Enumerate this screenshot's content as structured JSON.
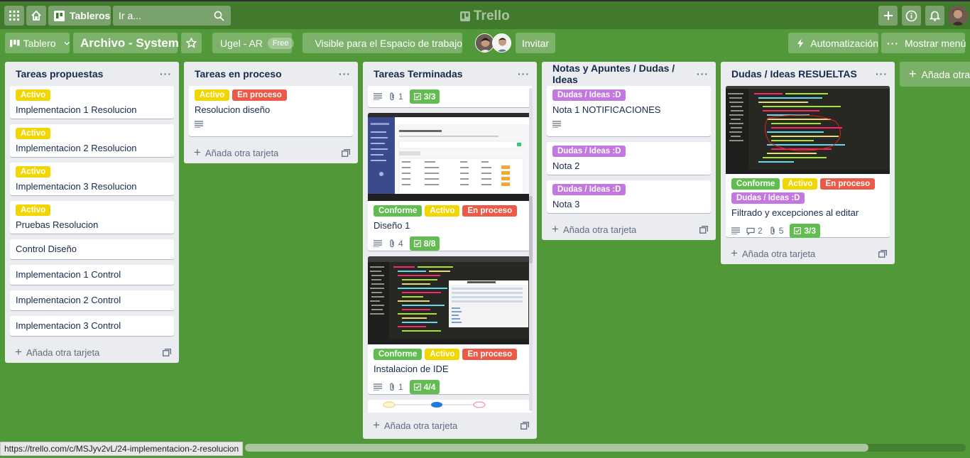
{
  "topbar": {
    "boards_label": "Tableros",
    "search_placeholder": "Ir a...",
    "logo_text": "Trello"
  },
  "board_header": {
    "view_label": "Tablero",
    "board_name": "Archivo - System",
    "workspace_name": "Ugel - AR",
    "workspace_plan": "Free",
    "visibility_label": "Visible para el Espacio de trabajo",
    "invite_label": "Invitar",
    "automation_label": "Automatización",
    "menu_label": "Mostrar menú"
  },
  "colors": {
    "board_bg": "#519839",
    "label_yellow": "#f2d600",
    "label_red": "#eb5a46",
    "label_green": "#61bd4f",
    "label_purple": "#c377e0"
  },
  "lists": [
    {
      "title": "Tareas propuestas",
      "add_label": "Añada otra tarjeta",
      "cards": [
        {
          "labels": [
            "Activo"
          ],
          "title": "Implementacion 1 Resolucion"
        },
        {
          "labels": [
            "Activo"
          ],
          "title": "Implementacion 2 Resolucion"
        },
        {
          "labels": [
            "Activo"
          ],
          "title": "Implementacion 3 Resolucion"
        },
        {
          "labels": [
            "Activo"
          ],
          "title": "Pruebas Resolucion"
        },
        {
          "title": "Control Diseño"
        },
        {
          "title": "Implementacion 1 Control"
        },
        {
          "title": "Implementacion 2 Control"
        },
        {
          "title": "Implementacion 3 Control"
        }
      ]
    },
    {
      "title": "Tareas en proceso",
      "add_label": "Añada otra tarjeta",
      "cards": [
        {
          "labels": [
            "Activo",
            "En proceso"
          ],
          "title": "Resolucion diseño"
        }
      ]
    },
    {
      "title": "Tareas Terminadas",
      "add_label": "Añada otra tarjeta",
      "cards": [
        {
          "attachments": "1",
          "checklist": "3/3"
        },
        {
          "labels": [
            "Conforme",
            "Activo",
            "En proceso"
          ],
          "title": "Diseño 1",
          "attachments": "4",
          "checklist": "8/8"
        },
        {
          "labels": [
            "Conforme",
            "Activo",
            "En proceso"
          ],
          "title": "Instalacion de IDE",
          "attachments": "1",
          "checklist": "4/4"
        }
      ]
    },
    {
      "title": "Notas y Apuntes / Dudas / Ideas",
      "add_label": "Añada otra tarjeta",
      "cards": [
        {
          "labels": [
            "Dudas / Ideas :D"
          ],
          "title": "Nota 1 NOTIFICACIONES"
        },
        {
          "labels": [
            "Dudas / Ideas :D"
          ],
          "title": "Nota 2"
        },
        {
          "labels": [
            "Dudas / Ideas :D"
          ],
          "title": "Nota 3"
        }
      ]
    },
    {
      "title": "Dudas / Ideas RESUELTAS",
      "add_label": "Añada otra tarjeta",
      "cards": [
        {
          "labels": [
            "Conforme",
            "Activo",
            "En proceso",
            "Dudas / Ideas :D"
          ],
          "title": "Filtrado y excepciones al editar",
          "comments": "2",
          "attachments": "5",
          "checklist": "3/3"
        }
      ]
    }
  ],
  "add_list_label": "Añada otra lista",
  "status_url": "https://trello.com/c/MSJyv2vL/24-implementacion-2-resolucion"
}
